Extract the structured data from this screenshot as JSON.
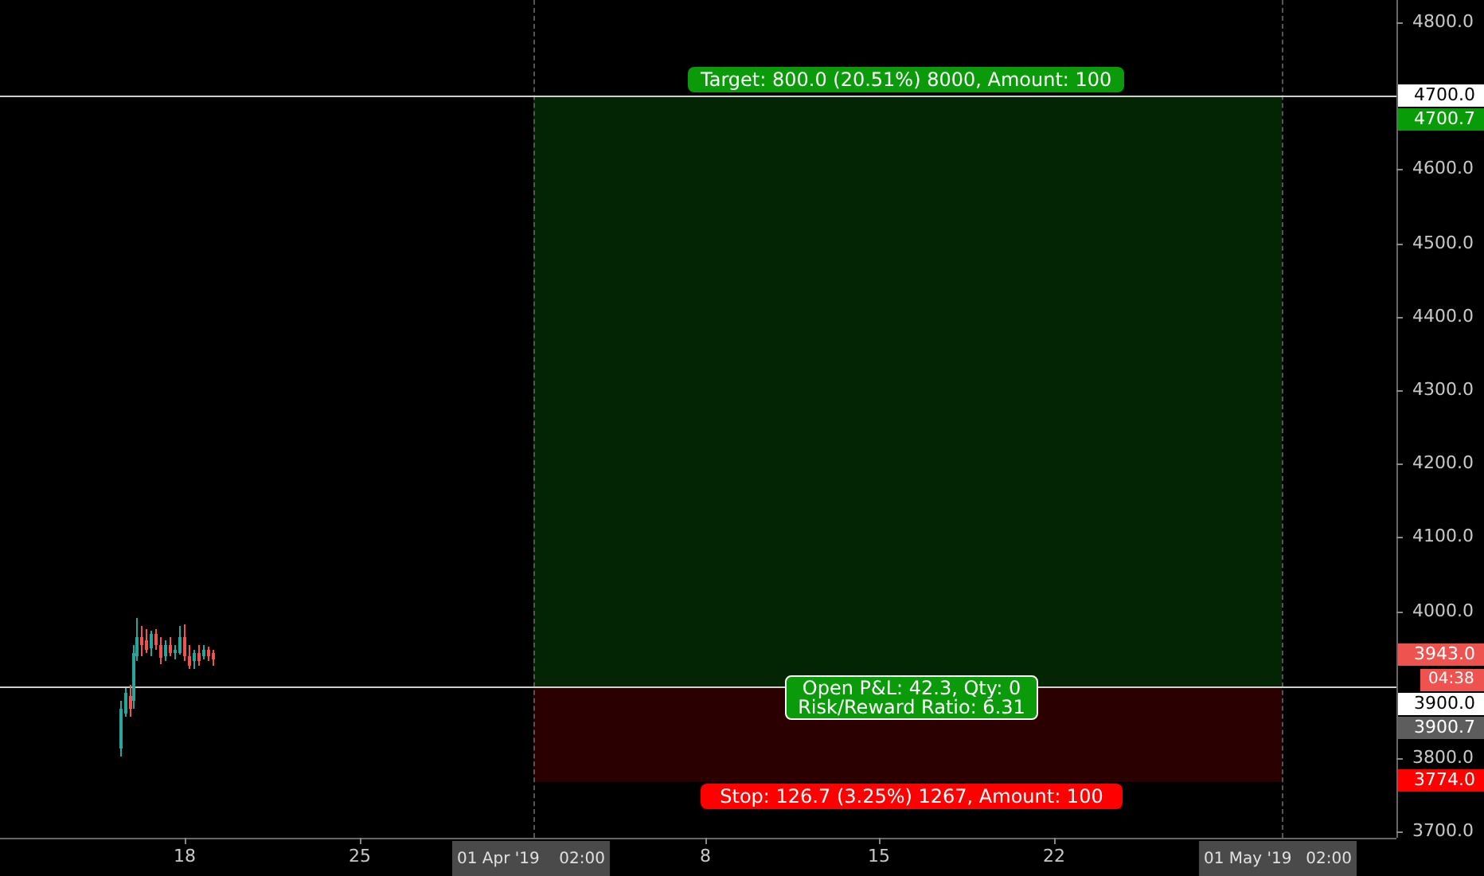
{
  "price_axis": {
    "ticks": [
      "4800.0",
      "4600.0",
      "4500.0",
      "4400.0",
      "4300.0",
      "4200.0",
      "4100.0",
      "4000.0",
      "3800.0",
      "3700.0"
    ],
    "badges": [
      {
        "text": "4700.0",
        "color": "#ffffff"
      },
      {
        "text": "4700.7",
        "color": "#089c08"
      },
      {
        "text": "3943.0",
        "color": "#ef5350"
      },
      {
        "text": "04:38",
        "color": "#ef5350"
      },
      {
        "text": "3900.0",
        "color": "#ffffff"
      },
      {
        "text": "3900.7",
        "color": "#5d5d5d"
      },
      {
        "text": "3774.0",
        "color": "#ff0000"
      }
    ]
  },
  "time_axis": {
    "ticks": [
      "18",
      "25",
      "8",
      "15",
      "22"
    ],
    "badges": [
      {
        "date": "01 Apr '19",
        "time": "02:00"
      },
      {
        "date": "01 May '19",
        "time": "02:00"
      }
    ]
  },
  "position": {
    "target": "Target: 800.0 (20.51%) 8000, Amount: 100",
    "pnl": "Open P&L: 42.3, Qty: 0",
    "ratio": "Risk/Reward Ratio: 6.31",
    "stop": "Stop: 126.7 (3.25%) 1267, Amount: 100"
  }
}
